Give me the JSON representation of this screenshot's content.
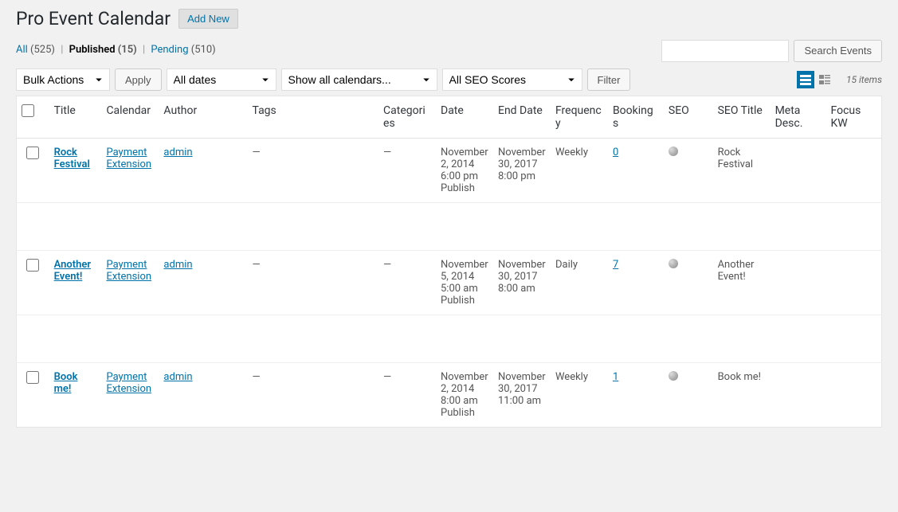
{
  "page_title": "Pro Event Calendar",
  "add_new_label": "Add New",
  "filters": {
    "all": {
      "label": "All",
      "count": "(525)"
    },
    "published": {
      "label": "Published",
      "count": "(15)"
    },
    "pending": {
      "label": "Pending",
      "count": "(510)"
    },
    "sep": "|"
  },
  "search": {
    "button": "Search Events"
  },
  "actions": {
    "bulk": "Bulk Actions",
    "apply": "Apply",
    "dates": "All dates",
    "calendars": "Show all calendars...",
    "seo": "All SEO Scores",
    "filter": "Filter"
  },
  "item_count": "15 items",
  "columns": {
    "title": "Title",
    "calendar": "Calendar",
    "author": "Author",
    "tags": "Tags",
    "categories": "Categories",
    "date": "Date",
    "end_date": "End Date",
    "frequency": "Frequency",
    "bookings": "Bookings",
    "seo": "SEO",
    "seo_title": "SEO Title",
    "meta_desc": "Meta Desc.",
    "focus_kw": "Focus KW"
  },
  "rows": [
    {
      "title": "Rock Festival",
      "calendar": "Payment Extension",
      "author": "admin",
      "tags": "—",
      "categories": "—",
      "date": "November 2, 2014 6:00 pm Publish",
      "end_date": "November 30, 2017 8:00 pm",
      "frequency": "Weekly",
      "bookings": "0",
      "seo_title": "Rock Festival",
      "meta_desc": "",
      "focus_kw": ""
    },
    {
      "title": "Another Event!",
      "calendar": "Payment Extension",
      "author": "admin",
      "tags": "—",
      "categories": "—",
      "date": "November 5, 2014 5:00 am Publish",
      "end_date": "November 30, 2017 8:00 am",
      "frequency": "Daily",
      "bookings": "7",
      "seo_title": "Another Event!",
      "meta_desc": "",
      "focus_kw": ""
    },
    {
      "title": "Book me!",
      "calendar": "Payment Extension",
      "author": "admin",
      "tags": "—",
      "categories": "—",
      "date": "November 2, 2014 8:00 am Publish",
      "end_date": "November 30, 2017 11:00 am",
      "frequency": "Weekly",
      "bookings": "1",
      "seo_title": "Book me!",
      "meta_desc": "",
      "focus_kw": ""
    }
  ]
}
